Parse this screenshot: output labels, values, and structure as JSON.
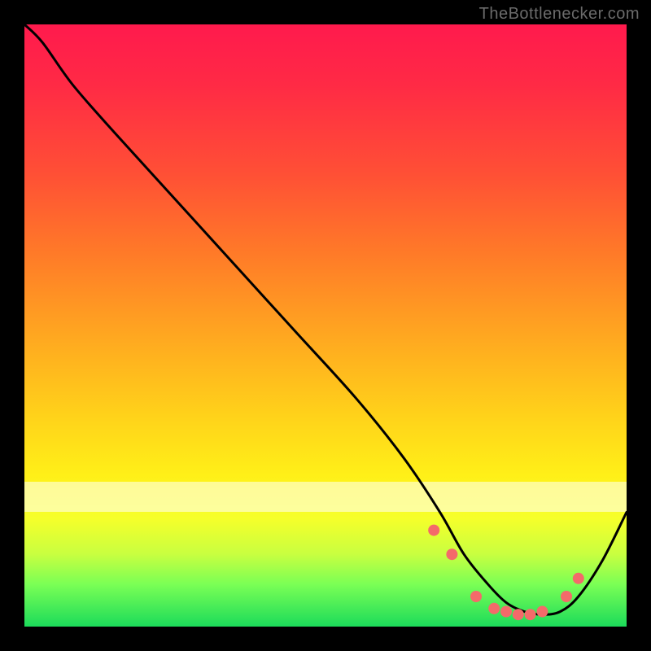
{
  "watermark": "TheBottleneсker.com",
  "chart_data": {
    "type": "line",
    "title": "",
    "xlabel": "",
    "ylabel": "",
    "xlim": [
      0,
      100
    ],
    "ylim": [
      0,
      100
    ],
    "x": [
      0,
      3,
      8,
      15,
      25,
      35,
      45,
      55,
      63,
      69,
      73,
      77,
      80,
      83,
      86,
      89,
      92,
      96,
      100
    ],
    "values": [
      100,
      97,
      90,
      82,
      71,
      60,
      49,
      38,
      28,
      19,
      12,
      7,
      4,
      2.5,
      2,
      2.5,
      5,
      11,
      19
    ],
    "markers": {
      "x": [
        68,
        71,
        75,
        78,
        80,
        82,
        84,
        86,
        90,
        92
      ],
      "y": [
        16,
        12,
        5,
        3,
        2.5,
        2,
        2,
        2.5,
        5,
        8
      ]
    },
    "background_gradient": {
      "stops": [
        {
          "pos": 0.0,
          "color": "#ff1a4d"
        },
        {
          "pos": 0.1,
          "color": "#ff2a45"
        },
        {
          "pos": 0.25,
          "color": "#ff5035"
        },
        {
          "pos": 0.38,
          "color": "#ff7a28"
        },
        {
          "pos": 0.52,
          "color": "#ffa820"
        },
        {
          "pos": 0.65,
          "color": "#ffd21a"
        },
        {
          "pos": 0.75,
          "color": "#fff018"
        },
        {
          "pos": 0.82,
          "color": "#f6ff2a"
        },
        {
          "pos": 0.88,
          "color": "#c8ff40"
        },
        {
          "pos": 0.93,
          "color": "#7aff55"
        },
        {
          "pos": 1.0,
          "color": "#1cdb5a"
        }
      ]
    },
    "marker_color": "#f46a6a",
    "curve_color": "#000000"
  }
}
